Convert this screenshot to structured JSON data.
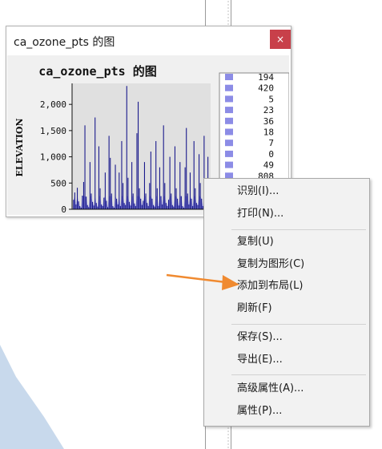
{
  "window": {
    "title": "ca_ozone_pts 的图",
    "close_label": "×"
  },
  "chart_data": {
    "type": "bar",
    "title": "ca_ozone_pts 的图",
    "ylabel": "ELEVATION",
    "xlabel": "",
    "ylim": [
      0,
      2400
    ],
    "yticks": [
      "0",
      "500",
      "1,000",
      "1,500",
      "2,000"
    ],
    "ytick_values": [
      0,
      500,
      1000,
      1500,
      2000
    ],
    "series_color": "#1a1a8c",
    "fill_color": "#8c8ce6",
    "values": [
      180,
      320,
      90,
      410,
      150,
      60,
      30,
      260,
      520,
      1600,
      240,
      80,
      40,
      900,
      300,
      140,
      70,
      1750,
      120,
      50,
      1200,
      400,
      90,
      60,
      220,
      700,
      160,
      40,
      1400,
      980,
      300,
      60,
      30,
      850,
      200,
      90,
      700,
      60,
      1300,
      500,
      120,
      80,
      2350,
      600,
      140,
      70,
      900,
      300,
      110,
      60,
      1450,
      2050,
      400,
      200,
      80,
      160,
      900,
      300,
      120,
      60,
      500,
      1100,
      200,
      80,
      50,
      1300,
      400,
      60,
      800,
      250,
      90,
      1600,
      500,
      120,
      60,
      180,
      1000,
      300,
      80,
      50,
      1200,
      400,
      200,
      70,
      900,
      250,
      60,
      30,
      800,
      1550,
      300,
      90,
      700,
      200,
      60,
      1300,
      400,
      120,
      80,
      1050,
      500,
      200,
      60,
      1400,
      300,
      100,
      1000,
      250
    ]
  },
  "legend": {
    "items": [
      "194",
      "420",
      "5",
      "23",
      "36",
      "18",
      "7",
      "0",
      "49",
      "808"
    ]
  },
  "context_menu": {
    "items": [
      {
        "label": "识别(I)..."
      },
      {
        "label": "打印(N)..."
      },
      {
        "label": "复制(U)"
      },
      {
        "label": "复制为图形(C)"
      },
      {
        "label": "添加到布局(L)"
      },
      {
        "label": "刷新(F)"
      },
      {
        "label": "保存(S)..."
      },
      {
        "label": "导出(E)..."
      },
      {
        "label": "高级属性(A)..."
      },
      {
        "label": "属性(P)..."
      }
    ]
  },
  "colors": {
    "map_fill": "#c8d9ec",
    "arrow": "#f08a30",
    "close_button": "#c8404a"
  }
}
